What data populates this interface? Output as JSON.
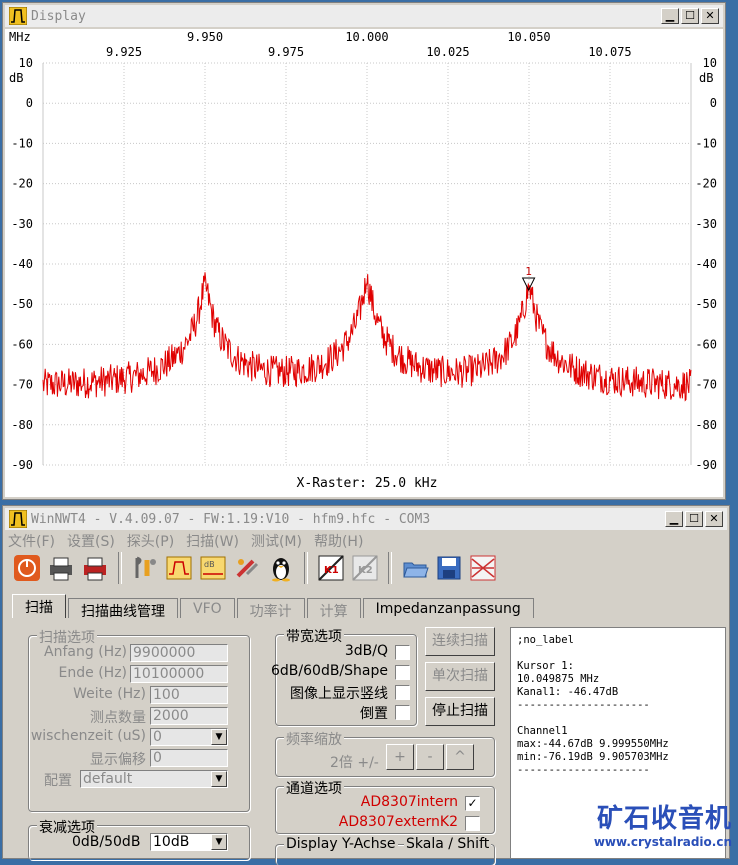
{
  "display_window": {
    "title": "Display",
    "unit_label": "MHz",
    "db_label": "dB",
    "raster_text": "X-Raster: 25.0 kHz",
    "marker_label": "1"
  },
  "chart_data": {
    "type": "line",
    "title": "",
    "xlabel": "MHz",
    "ylabel": "dB",
    "xlim": [
      9.9,
      10.1
    ],
    "ylim": [
      -90,
      10
    ],
    "xticks_top": [
      "9.950",
      "10.000",
      "10.050"
    ],
    "xticks_bottom": [
      "9.925",
      "9.975",
      "10.025",
      "10.075"
    ],
    "yticks": [
      "10",
      "0",
      "-10",
      "-20",
      "-30",
      "-40",
      "-50",
      "-60",
      "-70",
      "-80",
      "-90"
    ],
    "grid": true,
    "series": [
      {
        "color": "#e00000",
        "peaks": [
          {
            "x": 9.95,
            "y": -46
          },
          {
            "x": 10.0,
            "y": -45
          },
          {
            "x": 10.05,
            "y": -46.47
          }
        ],
        "noise_floor": -71
      }
    ],
    "marker": {
      "x": 10.049875,
      "y": -46.47
    }
  },
  "main_window": {
    "title": "WinNWT4 - V.4.09.07 - FW:1.19:V10 - hfm9.hfc - COM3"
  },
  "menu": [
    "文件(F)",
    "设置(S)",
    "探头(P)",
    "扫描(W)",
    "测试(M)",
    "帮助(H)"
  ],
  "tabs": [
    "扫描",
    "扫描曲线管理",
    "VFO",
    "功率计",
    "计算",
    "Impedanzanpassung"
  ],
  "scan_options": {
    "title": "扫描选项",
    "fields": [
      {
        "label": "Anfang (Hz)",
        "value": "9900000"
      },
      {
        "label": "Ende (Hz)",
        "value": "10100000"
      },
      {
        "label": "Weite (Hz)",
        "value": "100"
      },
      {
        "label": "测点数量",
        "value": "2000"
      },
      {
        "label": "wischenzeit (uS)",
        "value": "0"
      },
      {
        "label": "显示偏移",
        "value": "0"
      },
      {
        "label": "配置",
        "value": "default"
      }
    ]
  },
  "attenuation": {
    "title": "衰减选项",
    "label": "0dB/50dB",
    "value": "10dB"
  },
  "bandwidth": {
    "title": "带宽选项",
    "items": [
      {
        "label": "3dB/Q",
        "checked": false
      },
      {
        "label": "6dB/60dB/Shape",
        "checked": false
      },
      {
        "label": "图像上显示竖线",
        "checked": false
      },
      {
        "label": "倒置",
        "checked": false
      }
    ]
  },
  "freq_zoom": {
    "title": "频率缩放",
    "label": "2倍 +/-",
    "plus": "+",
    "minus": "-",
    "caret": "^"
  },
  "channels": {
    "title": "通道选项",
    "items": [
      {
        "label": "AD8307intern",
        "checked": true,
        "mark": "✓"
      },
      {
        "label": "AD8307externK2",
        "checked": false
      }
    ]
  },
  "display_y": {
    "label": "Display Y-Achse",
    "skala": "Skala / Shift"
  },
  "scan_buttons": [
    "连续扫描",
    "单次扫描",
    "停止扫描"
  ],
  "log_text": ";no_label\n\nKursor 1:\n10.049875 MHz\nKanal1: -46.47dB\n---------------------\n\nChannel1\nmax:-44.67dB 9.999550MHz\nmin:-76.19dB 9.905703MHz\n---------------------",
  "watermark": {
    "text": "矿石收音机",
    "url": "www.crystalradio.cn"
  }
}
